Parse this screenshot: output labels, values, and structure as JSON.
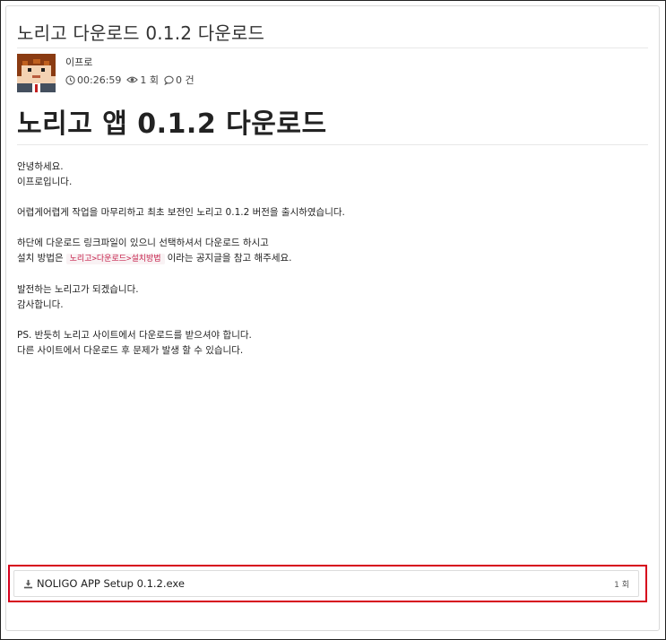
{
  "post": {
    "title": "노리고 다운로드 0.1.2 다운로드",
    "author": "이프로",
    "time": "00:26:59",
    "views": "1 회",
    "comments": "0 건",
    "heading": "노리고 앱 0.1.2 다운로드"
  },
  "content": {
    "p1_l1": "안녕하세요.",
    "p1_l2": "이프로입니다.",
    "p2": "어렵게어렵게 작업을 마무리하고 최초 보전인 노리고 0.1.2 버전을 출시하였습니다.",
    "p3_l1": "하단에 다운로드 링크파일이 있으니 선택하셔서 다운로드 하시고",
    "p3_l2_pre": "설치 방법은",
    "p3_l2_code": "노리고>다운로드>설치방법",
    "p3_l2_post": "이라는 공지글을 참고 해주세요.",
    "p4_l1": "발전하는 노리고가 되겠습니다.",
    "p4_l2": "감사합니다.",
    "p5_l1": "PS. 반듯히 노리고 사이트에서 다운로드를 받으셔야 합니다.",
    "p5_l2": "다른 사이트에서 다운로드 후 문제가 발생 할 수 있습니다."
  },
  "download": {
    "filename": "NOLIGO APP Setup 0.1.2.exe",
    "count": "1 회"
  },
  "icons": {
    "clock": "clock-icon",
    "eye": "eye-icon",
    "comment": "comment-icon",
    "download": "download-icon"
  },
  "colors": {
    "highlight_border": "#d6001c",
    "code_text": "#c7254e",
    "code_bg": "#f9f2f4"
  }
}
